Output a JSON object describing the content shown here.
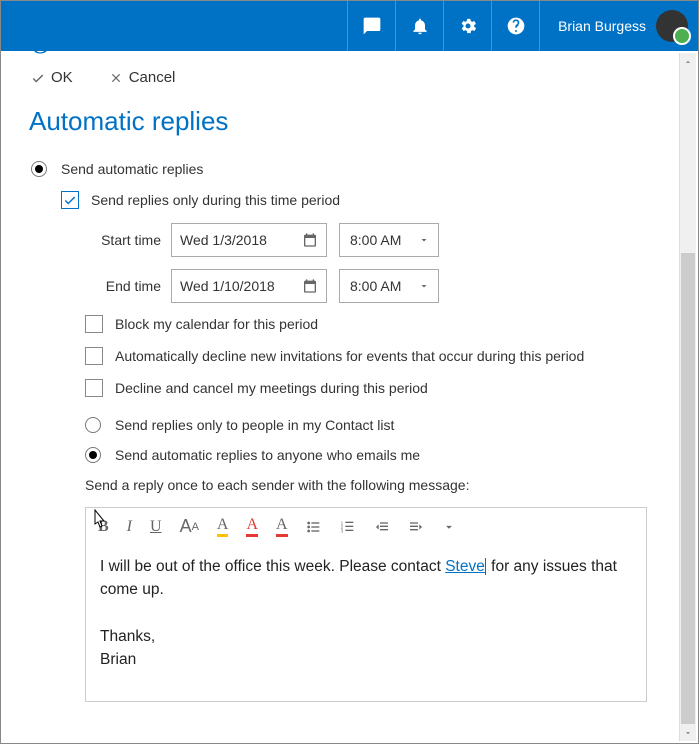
{
  "header": {
    "username": "Brian Burgess",
    "logo": "gP"
  },
  "actions": {
    "ok": "OK",
    "cancel": "Cancel"
  },
  "title": "Automatic replies",
  "opts": {
    "sendAuto": "Send automatic replies",
    "onlyPeriod": "Send replies only during this time period",
    "startLbl": "Start time",
    "startDate": "Wed 1/3/2018",
    "startTime": "8:00 AM",
    "endLbl": "End time",
    "endDate": "Wed 1/10/2018",
    "endTime": "8:00 AM",
    "block": "Block my calendar for this period",
    "decline": "Automatically decline new invitations for events that occur during this period",
    "cancelMtg": "Decline and cancel my meetings during this period",
    "contactsOnly": "Send replies only to people in my Contact list",
    "anyone": "Send automatic replies to anyone who emails me",
    "onceMsg": "Send a reply once to each sender with the following message:"
  },
  "msg": {
    "part1": "I will be out of the office this week. Please contact ",
    "link": "Steve",
    "part2": " for any issues that come up.",
    "thanks": "Thanks,",
    "sign": "Brian"
  }
}
